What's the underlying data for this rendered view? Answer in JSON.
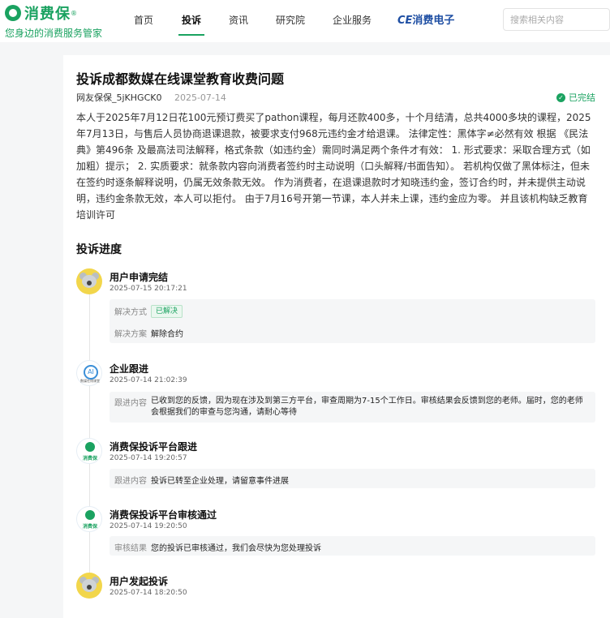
{
  "header": {
    "logo_name": "消费保",
    "logo_reg": "®",
    "logo_slogan": "您身边的消费服务管家",
    "nav": [
      "首页",
      "投诉",
      "资讯",
      "研究院",
      "企业服务"
    ],
    "active_nav": "投诉",
    "partner_logo_prefix": "CE",
    "partner_logo_text": "消费电子",
    "search_placeholder": "搜索相关内容"
  },
  "complaint": {
    "title": "投诉成都数媒在线课堂教育收费问题",
    "author": "网友保保_5jKHGCK0",
    "date": "2025-07-14",
    "status": "已完结",
    "description": "本人于2025年7月12日花100元预订费买了pathon课程，每月还款400多，十个月结清，总共4000多块的课程，2025年7月13日，与售后人员协商退课退款，被要求支付968元违约金才给退课。 法律定性：黑体字≠必然有效 根据 《民法典》第496条 及最高法司法解释，格式条款（如违约金）需同时满足两个条件才有效： 1. 形式要求：采取合理方式（如加粗）提示； 2. 实质要求：就条款内容向消费者签约时主动说明（口头解释/书面告知）。 若机构仅做了黑体标注，但未在签约时逐条解释说明，仍属无效条款无效。 作为消费者，在退课退款时才知晓违约金，签订合约时，并未提供主动说明，违约金条款无效，本人可以拒付。 由于7月16号开第一节课，本人并未上课，违约金应为零。 并且该机构缺乏教育培训许可"
  },
  "progress": {
    "section_title": "投诉进度",
    "items": [
      {
        "title": "用户申请完结",
        "time": "2025-07-15 20:17:21",
        "avatar": "koala-icon",
        "fields": [
          {
            "label": "解决方式",
            "value": "已解决",
            "badge": true
          },
          {
            "label": "解决方案",
            "value": "解除合约"
          }
        ]
      },
      {
        "title": "企业跟进",
        "time": "2025-07-14 21:02:39",
        "avatar": "company-icon",
        "avatar_sub": "数媒在线课堂",
        "fields": [
          {
            "label": "跟进内容",
            "value": "已收到您的反馈，因为现在涉及到第三方平台，审查周期为7-15个工作日。审核结果会反馈到您的老师。届时，您的老师会根据我们的审查与您沟通，请耐心等待"
          }
        ]
      },
      {
        "title": "消费保投诉平台跟进",
        "time": "2025-07-14 19:20:57",
        "avatar": "platform-icon",
        "avatar_sub": "消费保",
        "fields": [
          {
            "label": "跟进内容",
            "value": "投诉已转至企业处理，请留意事件进展"
          }
        ]
      },
      {
        "title": "消费保投诉平台审核通过",
        "time": "2025-07-14 19:20:50",
        "avatar": "platform-icon",
        "avatar_sub": "消费保",
        "fields": [
          {
            "label": "审核结果",
            "value": "您的投诉已审核通过，我们会尽快为您处理投诉"
          }
        ]
      },
      {
        "title": "用户发起投诉",
        "time": "2025-07-14 18:20:50",
        "avatar": "koala-icon",
        "fields": []
      }
    ]
  },
  "colors": {
    "brand_green": "#1aa260",
    "partner_blue": "#1f4fa3"
  }
}
